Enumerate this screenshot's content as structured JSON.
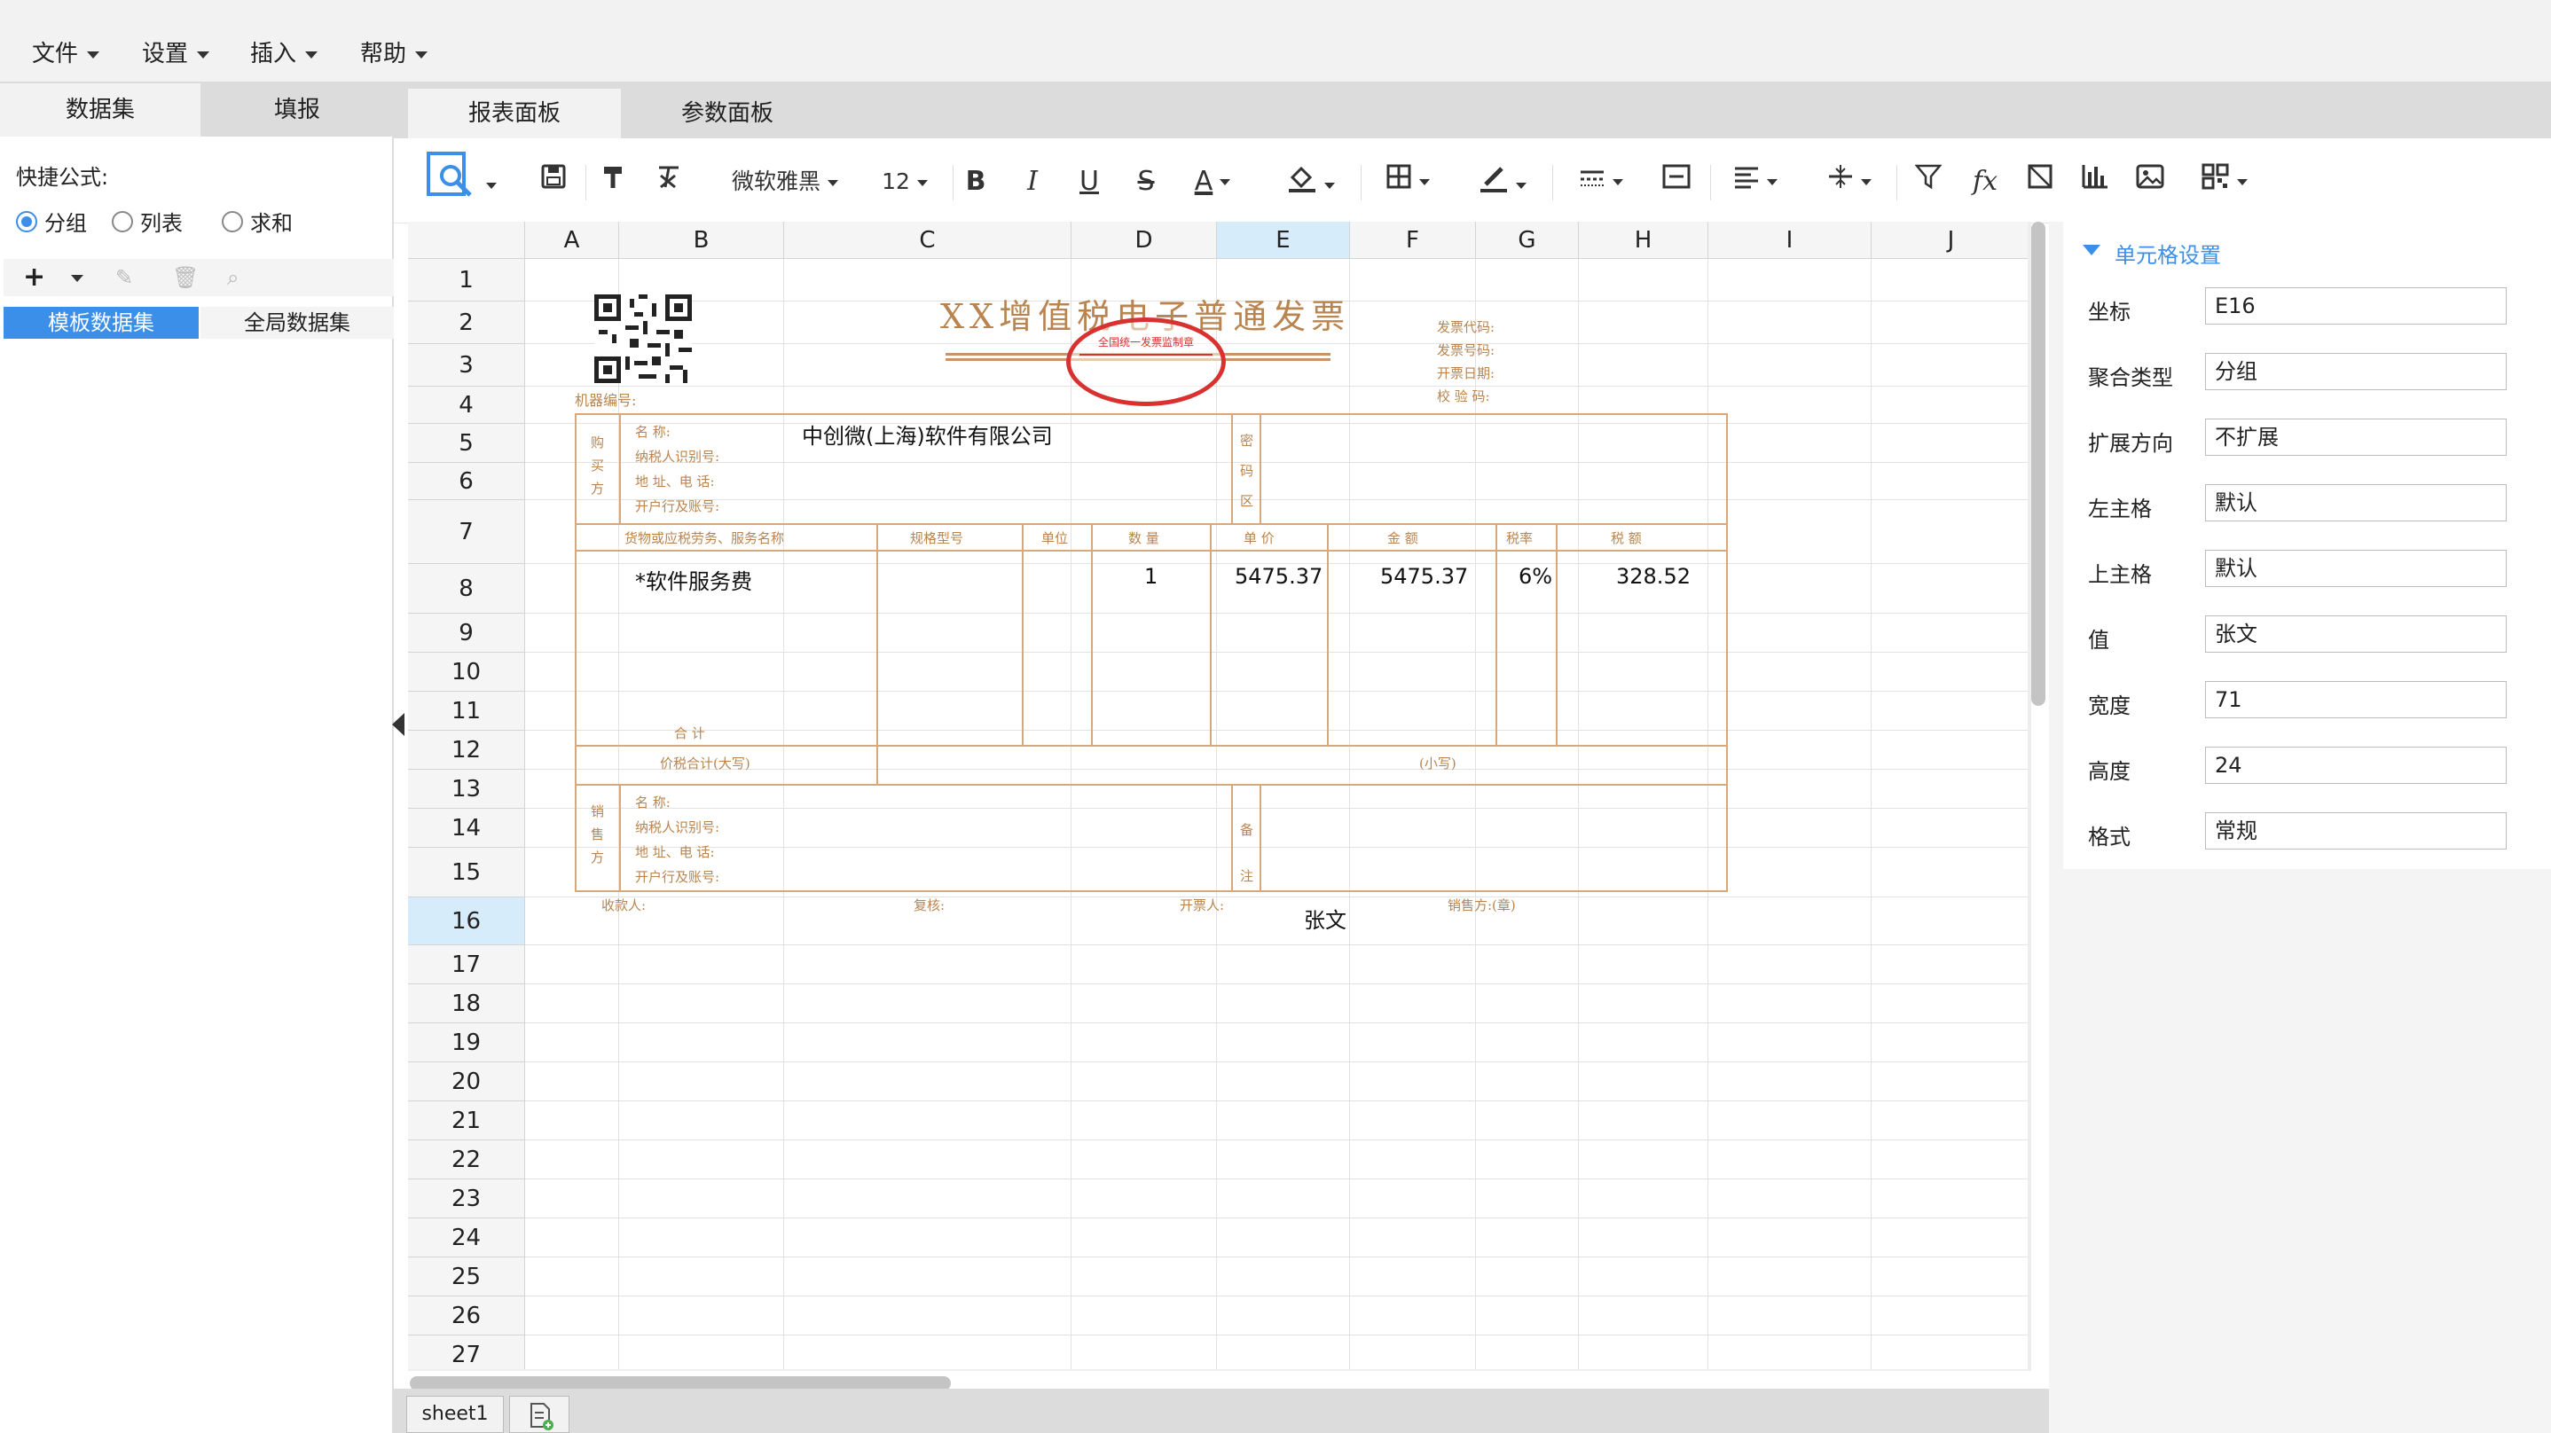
{
  "menu": [
    "文件",
    "设置",
    "插入",
    "帮助"
  ],
  "left": {
    "tabs": [
      "数据集",
      "填报"
    ],
    "quick_label": "快捷公式:",
    "radios": [
      "分组",
      "列表",
      "求和"
    ],
    "dataset_tabs": [
      "模板数据集",
      "全局数据集"
    ]
  },
  "report_tabs": [
    "报表面板",
    "参数面板"
  ],
  "toolbar": {
    "font": "微软雅黑",
    "size": "12",
    "bold": "B",
    "italic": "I",
    "underline": "U",
    "strike": "S",
    "fontcolor": "A",
    "fx": "fx"
  },
  "sheet": {
    "columns": [
      "A",
      "B",
      "C",
      "D",
      "E",
      "F",
      "G",
      "H",
      "I",
      "J"
    ],
    "rows": [
      "1",
      "2",
      "3",
      "4",
      "5",
      "6",
      "7",
      "8",
      "9",
      "10",
      "11",
      "12",
      "13",
      "14",
      "15",
      "16",
      "17",
      "18",
      "19",
      "20",
      "21",
      "22",
      "23",
      "24",
      "25",
      "26",
      "27"
    ],
    "cells": {
      "company": "中创微(上海)软件有限公司",
      "item": "*软件服务费",
      "qty": "1",
      "price": "5475.37",
      "amount": "5475.37",
      "rate": "6%",
      "tax": "328.52",
      "name": "张文"
    },
    "tab": "sheet1"
  },
  "invoice": {
    "title": "XX增值税电子普通发票",
    "stamp_text": "全国统一发票监制章",
    "machine": "机器编号:",
    "codes": [
      "发票代码:",
      "发票号码:",
      "开票日期:",
      "校 验 码:"
    ],
    "buyer": "购买方",
    "buyer_fields": [
      "名    称:",
      "纳税人识别号:",
      "地 址、电 话:",
      "开户行及账号:"
    ],
    "password": "密码区",
    "headers": [
      "货物或应税劳务、服务名称",
      "规格型号",
      "单位",
      "数 量",
      "单 价",
      "金 额",
      "税率",
      "税 额"
    ],
    "total": "合    计",
    "total_big": "价税合计(大写)",
    "total_small": "(小写)",
    "seller": "销售方",
    "remark": "备注",
    "bottom": [
      "收款人:",
      "复核:",
      "开票人:",
      "销售方:(章)"
    ]
  },
  "cell_settings": {
    "title": "单元格设置",
    "fields": [
      {
        "label": "坐标",
        "value": "E16"
      },
      {
        "label": "聚合类型",
        "value": "分组"
      },
      {
        "label": "扩展方向",
        "value": "不扩展"
      },
      {
        "label": "左主格",
        "value": "默认"
      },
      {
        "label": "上主格",
        "value": "默认"
      },
      {
        "label": "值",
        "value": "张文"
      },
      {
        "label": "宽度",
        "value": "71"
      },
      {
        "label": "高度",
        "value": "24"
      },
      {
        "label": "格式",
        "value": "常规"
      }
    ]
  }
}
